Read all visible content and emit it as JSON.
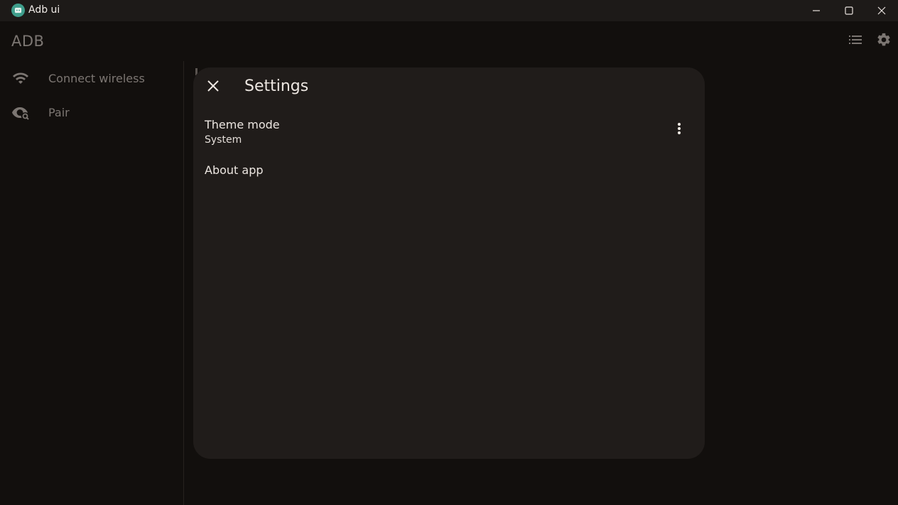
{
  "window": {
    "title": "Adb ui",
    "controls": [
      "minimize-icon",
      "maximize-icon",
      "close-icon"
    ]
  },
  "app": {
    "title": "ADB",
    "header_icons": [
      "list-icon",
      "gear-icon"
    ]
  },
  "sidebar": {
    "items": [
      {
        "label": "Connect wireless",
        "icon": "wifi-icon"
      },
      {
        "label": "Pair",
        "icon": "eye-search-icon"
      }
    ]
  },
  "settings_dialog": {
    "title": "Settings",
    "close_icon": "close-icon",
    "items": [
      {
        "title": "Theme mode",
        "value": "System",
        "action_icon": "more-vert-icon"
      },
      {
        "title": "About app"
      }
    ]
  },
  "colors": {
    "background": "#120f0d",
    "titlebar": "#1d1a18",
    "dialog": "#201c1a",
    "muted_text": "#7c7672",
    "accent_logo": "#3f9e8c"
  }
}
